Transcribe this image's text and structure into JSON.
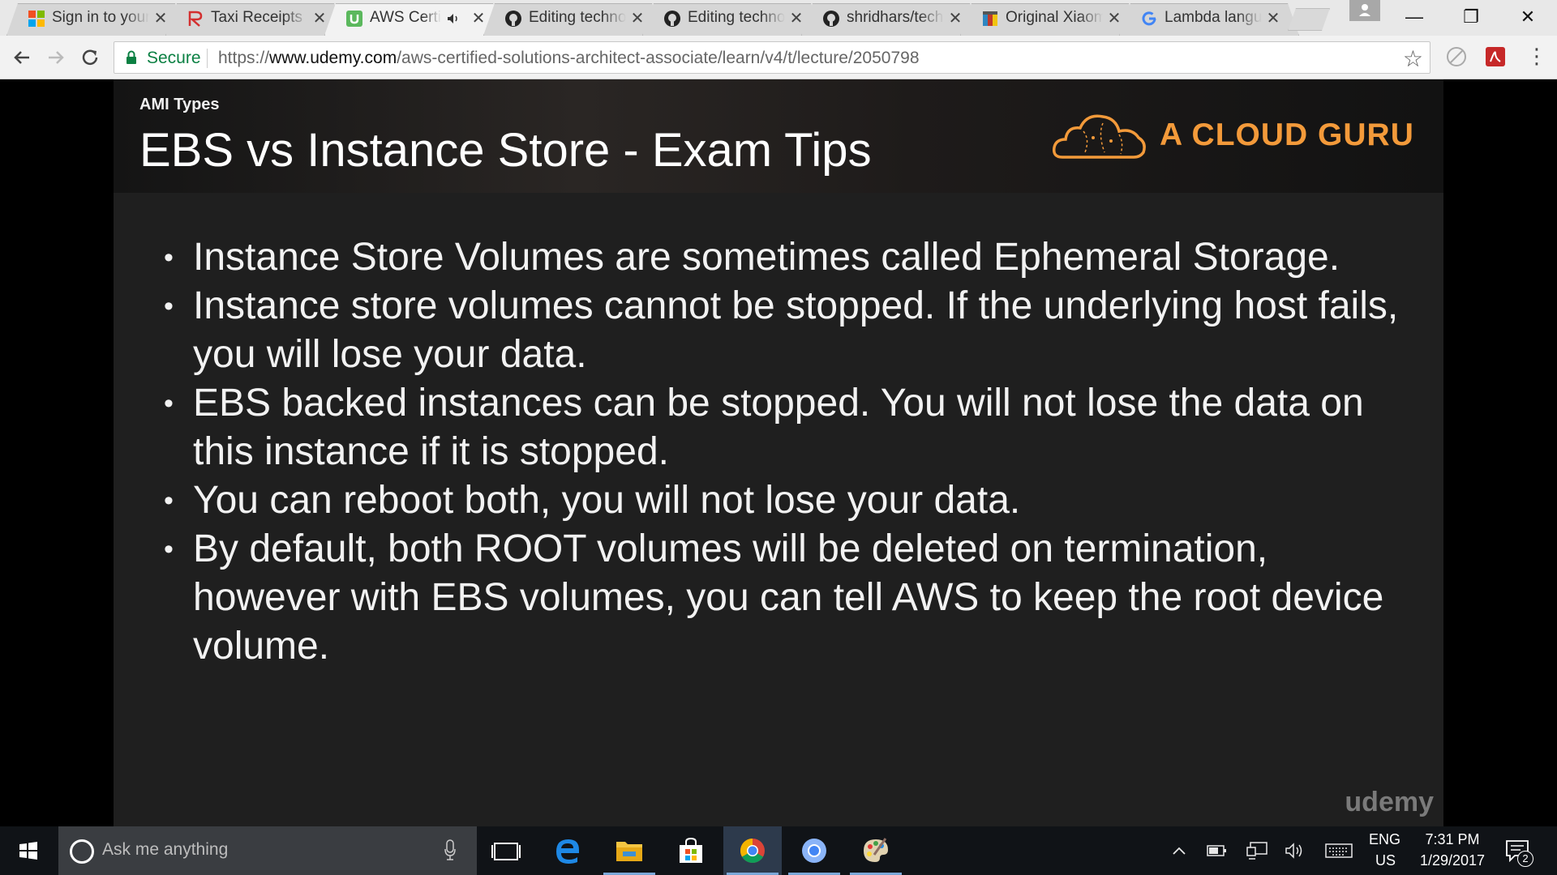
{
  "browser": {
    "tabs": [
      {
        "title": "Sign in to your",
        "icon": "microsoft-icon",
        "active": false
      },
      {
        "title": "Taxi Receipts",
        "icon": "receipt-r-icon",
        "active": false
      },
      {
        "title": "AWS Certified",
        "icon": "udemy-icon",
        "active": true,
        "audio": true
      },
      {
        "title": "Editing techno",
        "icon": "github-icon",
        "active": false
      },
      {
        "title": "Editing techno",
        "icon": "github-icon",
        "active": false
      },
      {
        "title": "shridhars/tech",
        "icon": "github-icon",
        "active": false
      },
      {
        "title": "Original Xiaom",
        "icon": "shop-icon",
        "active": false
      },
      {
        "title": "Lambda langu",
        "icon": "google-icon",
        "active": false
      }
    ],
    "close_glyph": "✕",
    "window_controls": {
      "minimize": "—",
      "restore": "❐",
      "close": "✕"
    },
    "address": {
      "secure_label": "Secure",
      "scheme": "https://",
      "host": "www.udemy.com",
      "path": "/aws-certified-solutions-architect-associate/learn/v4/t/lecture/2050798"
    },
    "star_glyph": "☆",
    "menu_glyph": "⋮"
  },
  "slide": {
    "section": "AMI Types",
    "title": "EBS vs Instance Store - Exam Tips",
    "logo_text": "A CLOUD GURU",
    "bullet_glyph": "•",
    "bullets": [
      "Instance Store Volumes are sometimes called Ephemeral Storage.",
      "Instance store volumes cannot be stopped. If the underlying host fails, you will lose your data.",
      "EBS backed instances can be stopped. You will not lose the data on this instance if it is stopped.",
      "You can reboot both, you will not lose your data.",
      "By default, both ROOT volumes will be deleted on termination, however with EBS volumes, you can tell AWS to keep the root device volume."
    ],
    "watermark": "udemy"
  },
  "taskbar": {
    "search_placeholder": "Ask me anything",
    "language_line1": "ENG",
    "language_line2": "US",
    "time": "7:31 PM",
    "date": "1/29/2017",
    "notification_count": "2",
    "accent_color": "#7aa7d8"
  }
}
